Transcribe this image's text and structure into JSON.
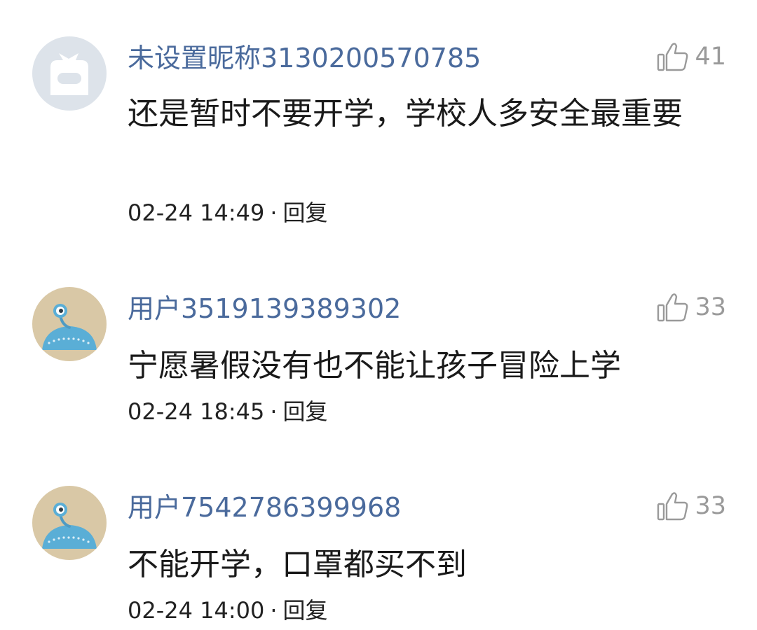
{
  "comments": [
    {
      "avatar": "default-cat-avatar",
      "username": "未设置昵称3130200570785",
      "likes": "41",
      "text": "还是暂时不要开学，学校人多安全最重要",
      "time": "02-24 14:49",
      "separator": "·",
      "reply": "回复"
    },
    {
      "avatar": "alien-ufo-avatar",
      "username": "用户3519139389302",
      "likes": "33",
      "text": "宁愿暑假没有也不能让孩子冒险上学",
      "time": "02-24 18:45",
      "separator": "·",
      "reply": "回复"
    },
    {
      "avatar": "alien-ufo-avatar",
      "username": "用户7542786399968",
      "likes": "33",
      "text": "不能开学，口罩都买不到",
      "time": "02-24 14:00",
      "separator": "·",
      "reply": "回复"
    }
  ],
  "colors": {
    "username": "#4a6a9c",
    "like_icon": "#9a9a9a",
    "body_text": "#1a1a1a",
    "avatar_default_bg": "#dde3ea",
    "alien_bg": "#d9c8a6",
    "alien_blue": "#5aaed6"
  }
}
